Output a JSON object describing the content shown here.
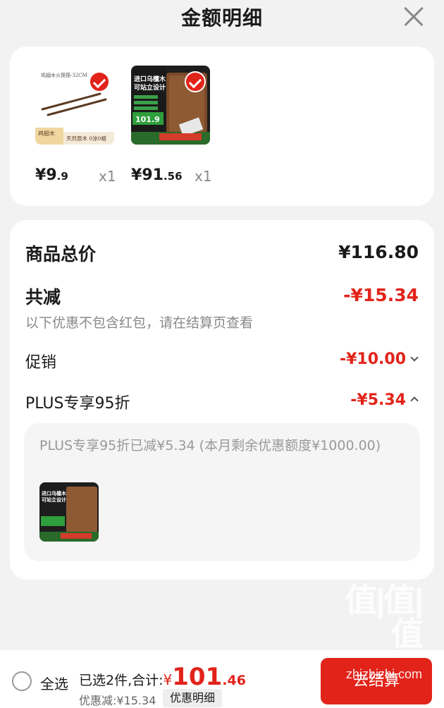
{
  "header": {
    "title": "金额明细"
  },
  "products": [
    {
      "price_yen": "¥",
      "price_int": "9",
      "price_dec": ".9",
      "qty": "x1",
      "thumb_label": "鸡翅木火筷筷-32CM",
      "thumb_tag": "鸡翅木",
      "thumb_sub": "天然原木 0涂0蜡"
    },
    {
      "price_yen": "¥",
      "price_int": "91",
      "price_dec": ".56",
      "qty": "x1",
      "thumb_label": "进口乌檀木 可站立设计",
      "thumb_price": "101.9"
    }
  ],
  "summary": {
    "total_label": "商品总价",
    "total_value": "¥116.80",
    "discount_label": "共减",
    "discount_value": "-¥15.34",
    "discount_note": "以下优惠不包含红包，请在结算页查看",
    "promo_label": "促销",
    "promo_value": "-¥10.00",
    "plus_label": "PLUS专享95折",
    "plus_value": "-¥5.34",
    "plus_detail": "PLUS专享95折已减¥5.34 (本月剩余优惠额度¥1000.00)"
  },
  "bottom": {
    "select_all": "全选",
    "selected_total_label": "已选2件,合计:",
    "total_yen": "¥",
    "total_int": "101",
    "total_dec": ".46",
    "saved": "优惠减:¥15.34",
    "detail_button": "优惠明细",
    "checkout": "去结算",
    "watermark_logo": "值|值|值",
    "watermark_url": "zhizhizhi.com"
  },
  "colors": {
    "accent": "#e2231a",
    "card": "#ffffff",
    "page": "#f2f2f2"
  }
}
